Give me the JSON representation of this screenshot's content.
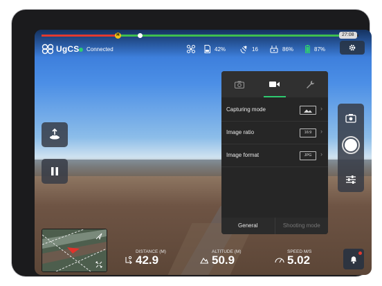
{
  "app": {
    "logo_text": "UgCS"
  },
  "status": {
    "connection": "Connected",
    "connection_color": "#2ecc71"
  },
  "timeline": {
    "time": "27:08",
    "marker_label": "H",
    "progress_red": 0.24,
    "progress_knob": 0.31,
    "progress_green_end": 0.95
  },
  "stats": {
    "sd_card": "42%",
    "satellites": "16",
    "remote_battery": "86%",
    "drone_battery": "87%"
  },
  "camera_panel": {
    "tabs": [
      "camera-tab",
      "video-tab",
      "settings-tab"
    ],
    "active_tab": "video-tab",
    "rows": [
      {
        "label": "Capturing mode",
        "icon": "image-icon",
        "value": ""
      },
      {
        "label": "Image ratio",
        "icon": "ratio-badge",
        "value": "16:9"
      },
      {
        "label": "Image format",
        "icon": "format-badge",
        "value": "JPG"
      }
    ],
    "footer": {
      "general": "General",
      "shooting_mode": "Shooting mode"
    }
  },
  "telemetry": {
    "distance": {
      "label": "DISTANCE (M)",
      "value": "42.9"
    },
    "altitude": {
      "label": "ALTITUDE (M)",
      "value": "50.9"
    },
    "speed": {
      "label": "SPEED M/S",
      "value": "5.02"
    }
  },
  "colors": {
    "accent_green": "#2ecc71",
    "progress_red": "#e23a2f",
    "marker_yellow": "#f0c419"
  }
}
